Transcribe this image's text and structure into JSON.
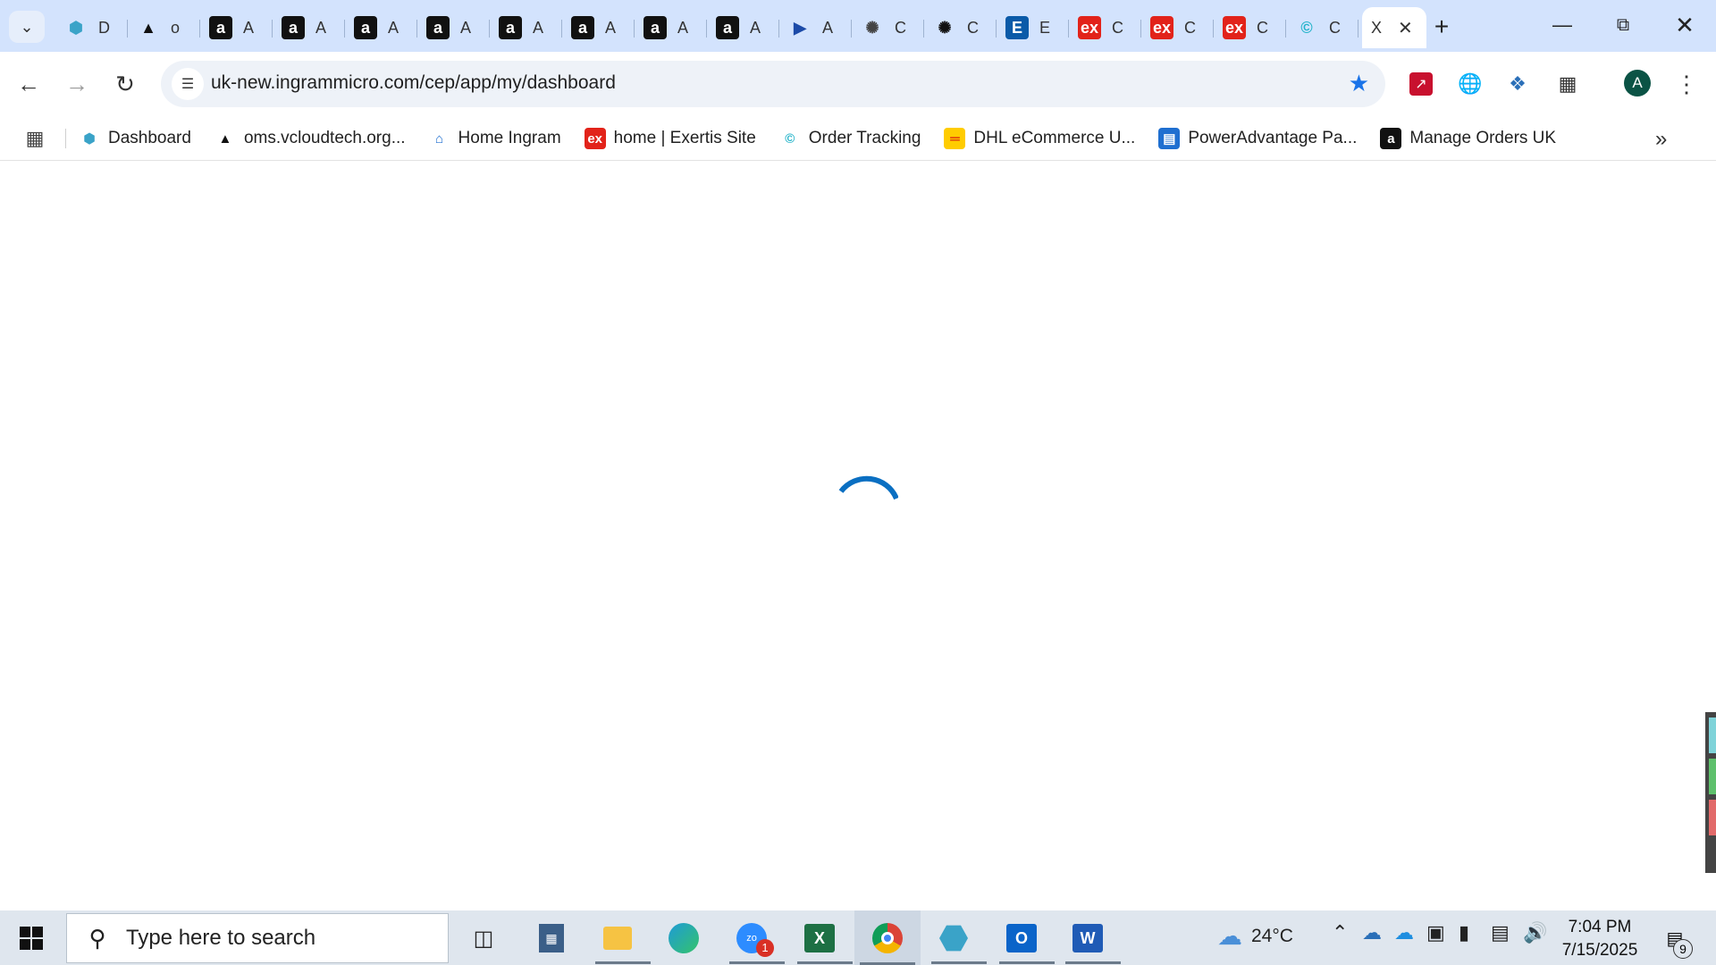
{
  "browser": {
    "tabs": [
      {
        "title": "D",
        "icon": "hex-icon",
        "color": "#3aa3c8"
      },
      {
        "title": "o",
        "icon": "triangle-icon",
        "color": "#111111"
      },
      {
        "title": "A",
        "icon": "amazon-icon",
        "color": "#111111"
      },
      {
        "title": "A",
        "icon": "amazon-icon",
        "color": "#111111"
      },
      {
        "title": "A",
        "icon": "amazon-icon",
        "color": "#111111"
      },
      {
        "title": "A",
        "icon": "amazon-icon",
        "color": "#111111"
      },
      {
        "title": "A",
        "icon": "amazon-icon",
        "color": "#111111"
      },
      {
        "title": "A",
        "icon": "amazon-icon",
        "color": "#111111"
      },
      {
        "title": "A",
        "icon": "amazon-icon",
        "color": "#111111"
      },
      {
        "title": "A",
        "icon": "amazon-icon",
        "color": "#111111"
      },
      {
        "title": "A",
        "icon": "arrow-play-icon",
        "color": "#1b4aa8"
      },
      {
        "title": "C",
        "icon": "openai-icon",
        "color": "#444444"
      },
      {
        "title": "C",
        "icon": "openai-icon",
        "color": "#111111"
      },
      {
        "title": "E",
        "icon": "e-letter-icon",
        "color": "#0a5aa8"
      },
      {
        "title": "C",
        "icon": "exertis-icon",
        "color": "#e2231a"
      },
      {
        "title": "C",
        "icon": "exertis-icon",
        "color": "#e2231a"
      },
      {
        "title": "C",
        "icon": "exertis-icon",
        "color": "#e2231a"
      },
      {
        "title": "C",
        "icon": "c-swirl-icon",
        "color": "#22b3c9"
      },
      {
        "title": "X",
        "icon": "close-icon",
        "color": "#222222",
        "active": true
      }
    ],
    "address": {
      "url": "uk-new.ingrammicro.com/cep/app/my/dashboard"
    },
    "profile_initial": "A",
    "bookmarks": [
      {
        "label": "Dashboard",
        "icon": "hex-icon",
        "color": "#3aa3c8"
      },
      {
        "label": "oms.vcloudtech.org...",
        "icon": "triangle-icon",
        "color": "#111111"
      },
      {
        "label": "Home Ingram",
        "icon": "ingram-icon",
        "color": "#1f6fd0"
      },
      {
        "label": "home | Exertis Site",
        "icon": "exertis-icon",
        "color": "#e2231a"
      },
      {
        "label": "Order Tracking",
        "icon": "c-swirl-icon",
        "color": "#22b3c9"
      },
      {
        "label": "DHL eCommerce U...",
        "icon": "dhl-icon",
        "color": "#ffcc00"
      },
      {
        "label": "PowerAdvantage Pa...",
        "icon": "document-icon",
        "color": "#1f6fd0"
      },
      {
        "label": "Manage Orders UK",
        "icon": "amazon-icon",
        "color": "#111111"
      }
    ]
  },
  "taskbar": {
    "search_placeholder": "Type here to search",
    "temperature": "24°C",
    "time": "7:04 PM",
    "date": "7/15/2025",
    "zoom_badge": "1",
    "notification_count": "9"
  }
}
